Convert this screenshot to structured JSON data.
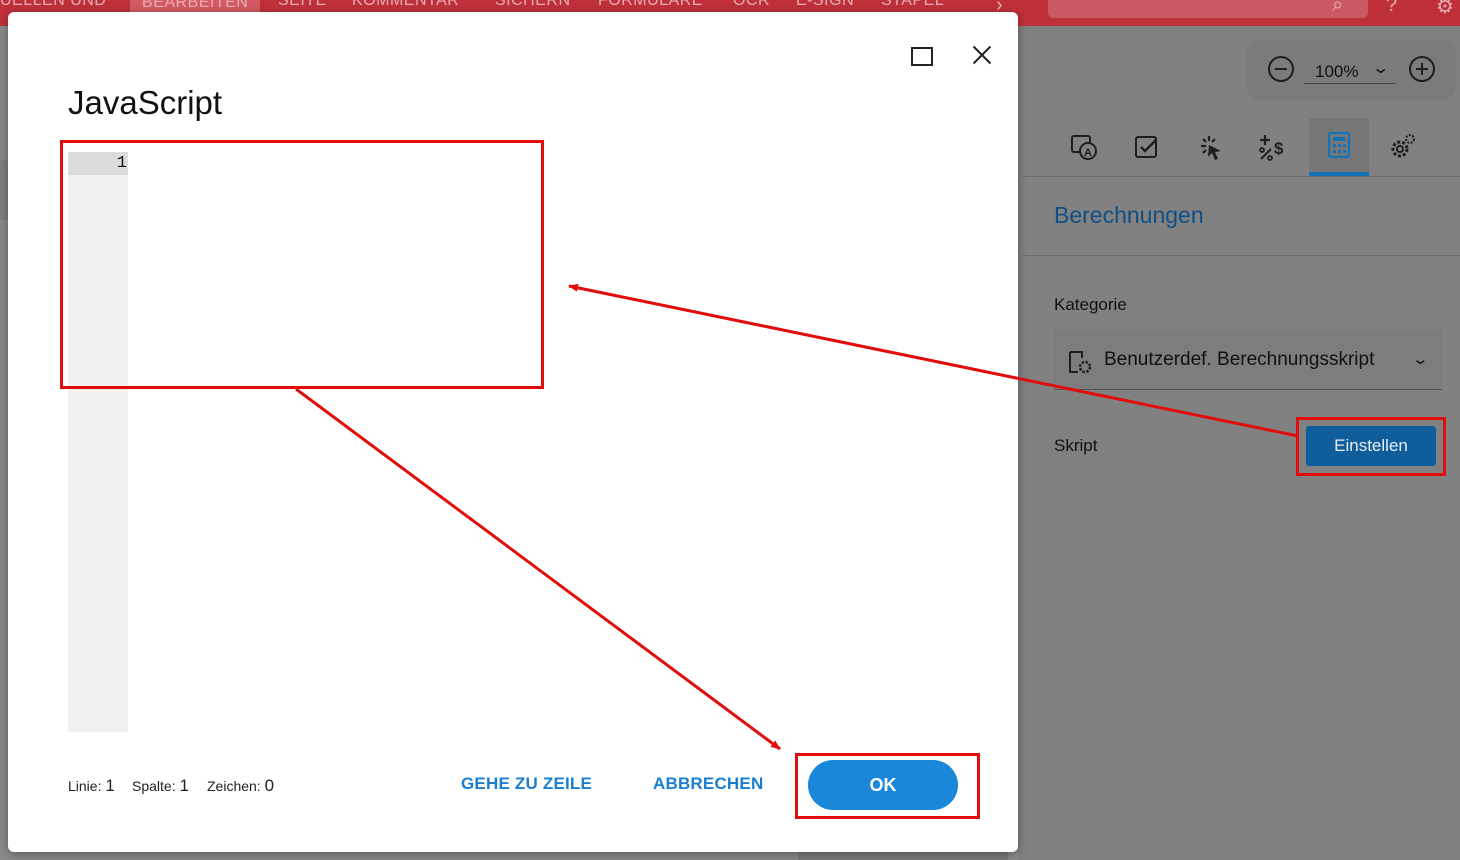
{
  "topbar": {
    "tabs": [
      "UELLEN UND",
      "BEARBEITEN",
      "SEITE",
      "KOMMENTAR",
      "SICHERN",
      "FORMULARE",
      "OCR",
      "E-SIGN",
      "STAPEL"
    ],
    "active_tab": "BEARBEITEN"
  },
  "zoom": {
    "value": "100%"
  },
  "panel": {
    "title": "Berechnungen",
    "category_label": "Kategorie",
    "category_value": "Benutzerdef. Berechnungsskript",
    "script_label": "Skript",
    "script_button": "Einstellen",
    "tools": [
      "text-field-icon",
      "checkbox-icon",
      "action-icon",
      "format-icon",
      "calculator-icon",
      "settings-icon"
    ],
    "active_tool": "calculator-icon"
  },
  "dialog": {
    "title": "JavaScript",
    "editor": {
      "line_numbers": [
        "1"
      ],
      "content": ""
    },
    "status": {
      "line_label": "Linie:",
      "line_value": "1",
      "column_label": "Spalte:",
      "column_value": "1",
      "chars_label": "Zeichen:",
      "chars_value": "0"
    },
    "buttons": {
      "goto_line": "GEHE ZU ZEILE",
      "cancel": "ABBRECHEN",
      "ok": "OK"
    }
  },
  "colors": {
    "annotation": "#e10d0d",
    "accent": "#1a87da",
    "topbar": "#c0303a"
  }
}
